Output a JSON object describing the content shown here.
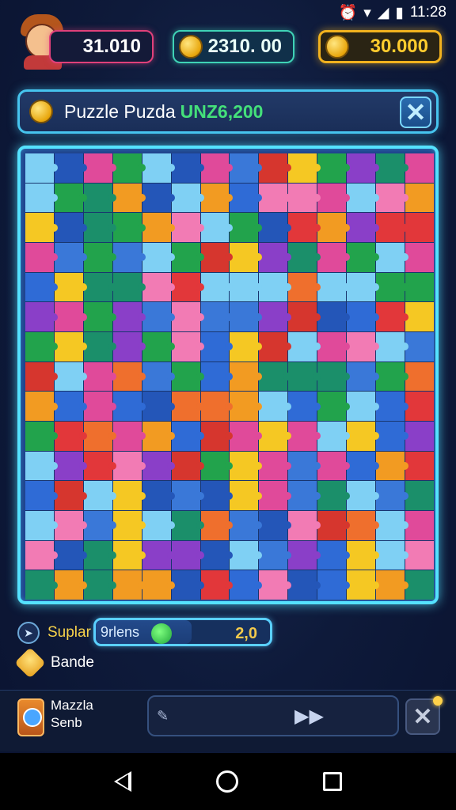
{
  "status_bar": {
    "time": "11:28",
    "icons": [
      "alarm-icon",
      "wifi-icon",
      "signal-icon",
      "battery-icon"
    ]
  },
  "header": {
    "player_score": "31.010",
    "coins": "2310. 00",
    "gold": "30.000"
  },
  "title_bar": {
    "title": "Puzzle Puzda",
    "amount": "UNZ6,200",
    "close_label": "✕"
  },
  "board": {
    "palette": [
      "#2f6bd6",
      "#e04a9a",
      "#f29b22",
      "#22a34c",
      "#e2373a",
      "#f5c823",
      "#7fd0f4",
      "#2456b8",
      "#d6362e",
      "#1b8f6a",
      "#8a3fc8",
      "#ef6f2d",
      "#3a78d8",
      "#f27bb4"
    ],
    "rows": 15,
    "cols": 14
  },
  "info": {
    "label": "Suplar",
    "progress_label": "9rlens",
    "progress_value": "2,0",
    "progress_fraction": 0.55
  },
  "bonus": {
    "label": "Bande"
  },
  "bottom_bar": {
    "line1": "Mazzla",
    "line2": "Senb",
    "erase_icon": "✎",
    "next_icon": "▶▶",
    "close_label": "✕"
  }
}
